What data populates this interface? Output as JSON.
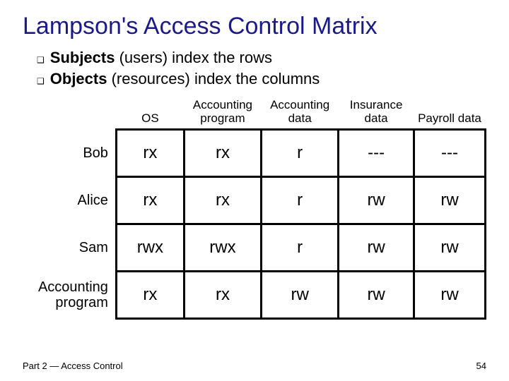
{
  "title": "Lampson's Access Control Matrix",
  "bullets": [
    {
      "bold": "Subjects",
      "rest": " (users) index the rows"
    },
    {
      "bold": "Objects",
      "rest": " (resources) index the columns"
    }
  ],
  "columns": [
    "OS",
    "Accounting program",
    "Accounting data",
    "Insurance data",
    "Payroll data"
  ],
  "rows": [
    {
      "label": "Bob",
      "cells": [
        "rx",
        "rx",
        "r",
        "---",
        "---"
      ]
    },
    {
      "label": "Alice",
      "cells": [
        "rx",
        "rx",
        "r",
        "rw",
        "rw"
      ]
    },
    {
      "label": "Sam",
      "cells": [
        "rwx",
        "rwx",
        "r",
        "rw",
        "rw"
      ]
    },
    {
      "label": "Accounting program",
      "cells": [
        "rx",
        "rx",
        "rw",
        "rw",
        "rw"
      ]
    }
  ],
  "footer": {
    "left": "Part 2 — Access Control",
    "right": "54"
  },
  "chart_data": {
    "type": "table",
    "title": "Lampson's Access Control Matrix",
    "columns": [
      "OS",
      "Accounting program",
      "Accounting data",
      "Insurance data",
      "Payroll data"
    ],
    "rows": [
      "Bob",
      "Alice",
      "Sam",
      "Accounting program"
    ],
    "values": [
      [
        "rx",
        "rx",
        "r",
        "---",
        "---"
      ],
      [
        "rx",
        "rx",
        "r",
        "rw",
        "rw"
      ],
      [
        "rwx",
        "rwx",
        "r",
        "rw",
        "rw"
      ],
      [
        "rx",
        "rx",
        "rw",
        "rw",
        "rw"
      ]
    ]
  }
}
